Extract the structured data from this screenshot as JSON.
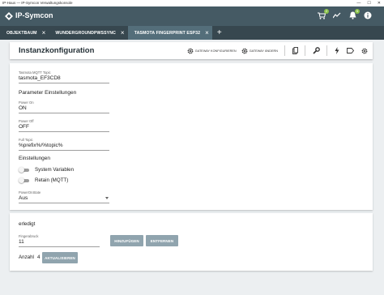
{
  "window": {
    "title": "IP-Haus — IP-Symcon Verwaltungskonsole"
  },
  "app": {
    "name": "IP-Symcon",
    "badges": {
      "notifications": "2",
      "alerts": "5"
    }
  },
  "tabs": [
    {
      "label": "OBJEKTBAUM",
      "active": false
    },
    {
      "label": "WUNDERGROUNDPWSSYNC",
      "active": false
    },
    {
      "label": "TASMOTA FINGERPRINT ESP32",
      "active": true
    }
  ],
  "header": {
    "title": "Instanzkonfiguration",
    "gateway_configure": "GATEWAY KONFIGURIEREN",
    "gateway_change": "GATEWAY ÄNDERN"
  },
  "form": {
    "mqtt_topic": {
      "label": "Tasmota MQTT Topic",
      "value": "tasmota_EF3CD8"
    },
    "param_section": "Parameter Einstellungen",
    "power_on": {
      "label": "Power On",
      "value": "ON"
    },
    "power_off": {
      "label": "Power Off",
      "value": "OFF"
    },
    "full_topic": {
      "label": "Full Topic",
      "value": "%prefix%/%topic%"
    },
    "settings_section": "Einstellungen",
    "toggle_system_vars": {
      "label": "System Variablen",
      "on": false
    },
    "toggle_retain": {
      "label": "Retain (MQTT)",
      "on": false
    },
    "power_on_state": {
      "label": "PowerOnState",
      "value": "Aus"
    }
  },
  "actions": {
    "status": "erledigt",
    "finger_id": {
      "label": "Fingerabruck",
      "value": "11"
    },
    "add_label": "HINZUFÜGEN",
    "remove_label": "ENTFERNEN",
    "count_label": "Anzahl",
    "count_value": "4",
    "refresh_label": "AKTUALISIEREN"
  },
  "colors": {
    "appbar": "#455a64",
    "tabbar": "#37474f",
    "active_tab": "#546e7a",
    "button": "#90a4ae",
    "badge": "#8bc34a"
  }
}
